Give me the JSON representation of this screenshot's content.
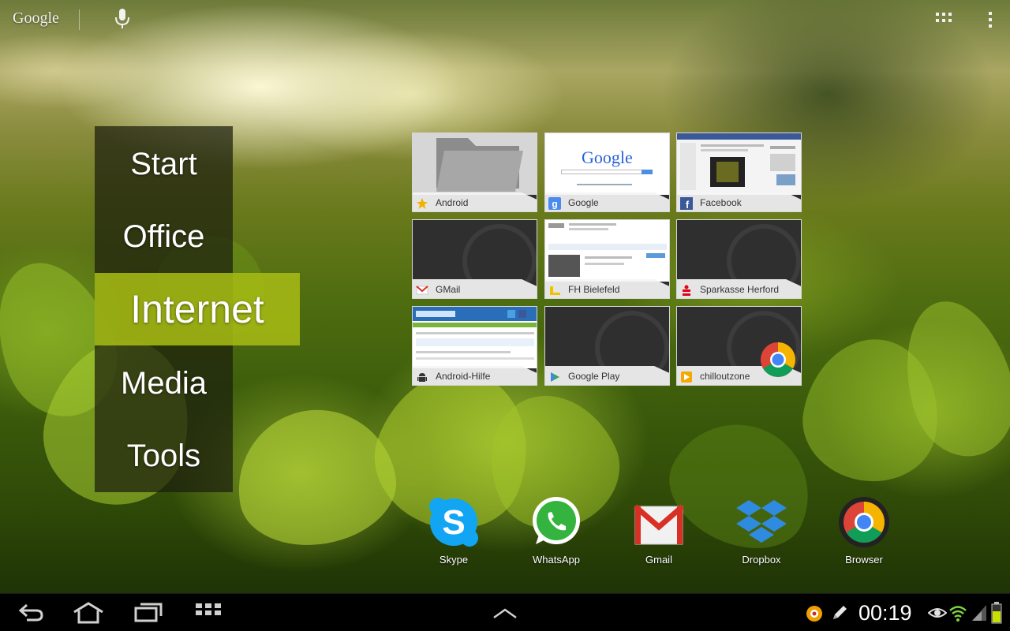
{
  "search_bar": {
    "logo_text": "Google",
    "icons": [
      "mic-icon",
      "apps-grid-icon",
      "overflow-menu-icon"
    ]
  },
  "category_menu": {
    "items": [
      "Start",
      "Office",
      "Internet",
      "Media",
      "Tools"
    ],
    "selected": "Internet"
  },
  "bookmarks": [
    {
      "label": "Android",
      "icon": "star-icon"
    },
    {
      "label": "Google",
      "icon": "google-favicon"
    },
    {
      "label": "Facebook",
      "icon": "facebook-favicon"
    },
    {
      "label": "GMail",
      "icon": "gmail-favicon"
    },
    {
      "label": "FH Bielefeld",
      "icon": "fh-bielefeld-favicon"
    },
    {
      "label": "Sparkasse Herford",
      "icon": "sparkasse-favicon"
    },
    {
      "label": "Android-Hilfe",
      "icon": "android-favicon"
    },
    {
      "label": "Google Play",
      "icon": "play-favicon"
    },
    {
      "label": "chilloutzone",
      "icon": "chilloutzone-favicon"
    }
  ],
  "bookmark_thumbs": {
    "google_logo": "Google"
  },
  "dock": [
    {
      "label": "Skype",
      "icon": "skype-icon"
    },
    {
      "label": "WhatsApp",
      "icon": "whatsapp-icon"
    },
    {
      "label": "Gmail",
      "icon": "gmail-icon"
    },
    {
      "label": "Dropbox",
      "icon": "dropbox-icon"
    },
    {
      "label": "Browser",
      "icon": "chrome-icon"
    }
  ],
  "system_bar": {
    "clock": "00:19",
    "nav_icons": [
      "back-icon",
      "home-icon",
      "recent-apps-icon",
      "app-drawer-icon",
      "chevron-up-icon"
    ],
    "status_icons": [
      "notification-icon",
      "pen-icon",
      "eye-icon",
      "wifi-icon",
      "signal-icon",
      "battery-icon"
    ]
  },
  "colors": {
    "menu_bg": "#1c1e0e",
    "menu_active": "#a5b914",
    "system_bar": "#000000",
    "battery_fill": "#c8e000",
    "wifi": "#7fd43c"
  }
}
